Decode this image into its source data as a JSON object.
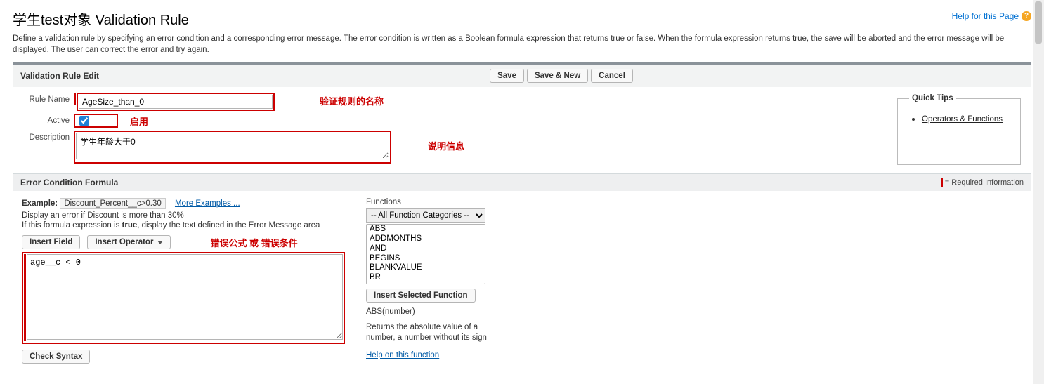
{
  "header": {
    "title": "学生test对象 Validation Rule",
    "help_label": "Help for this Page"
  },
  "intro": "Define a validation rule by specifying an error condition and a corresponding error message. The error condition is written as a Boolean formula expression that returns true or false. When the formula expression returns true, the save will be aborted and the error message will be displayed. The user can correct the error and try again.",
  "edit": {
    "section_title": "Validation Rule Edit",
    "buttons": {
      "save": "Save",
      "save_new": "Save & New",
      "cancel": "Cancel"
    },
    "rule_name_label": "Rule Name",
    "rule_name_value": "AgeSize_than_0",
    "active_label": "Active",
    "active_checked": true,
    "description_label": "Description",
    "description_value": "学生年龄大于0",
    "annot_rule_name": "验证规则的名称",
    "annot_active": "启用",
    "annot_description": "说明信息"
  },
  "quick_tips": {
    "legend": "Quick Tips",
    "link": "Operators & Functions"
  },
  "formula": {
    "section_title": "Error Condition Formula",
    "required_info": "= Required Information",
    "example_label": "Example:",
    "example_code": "Discount_Percent__c>0.30",
    "more_examples": "More Examples ...",
    "example_desc": "Display an error if Discount is more than 30%",
    "instruction_prefix": "If this formula expression is ",
    "instruction_bold": "true",
    "instruction_suffix": ", display the text defined in the Error Message area",
    "insert_field": "Insert Field",
    "insert_operator": "Insert Operator",
    "annot_formula": "错误公式  或  错误条件",
    "formula_value": "age__c < 0",
    "check_syntax": "Check Syntax"
  },
  "functions": {
    "label": "Functions",
    "category_selected": "-- All Function Categories --",
    "list": [
      "ABS",
      "ADDMONTHS",
      "AND",
      "BEGINS",
      "BLANKVALUE",
      "BR"
    ],
    "insert_selected": "Insert Selected Function",
    "signature": "ABS(number)",
    "description": "Returns the absolute value of a number, a number without its sign",
    "help_link": "Help on this function"
  }
}
